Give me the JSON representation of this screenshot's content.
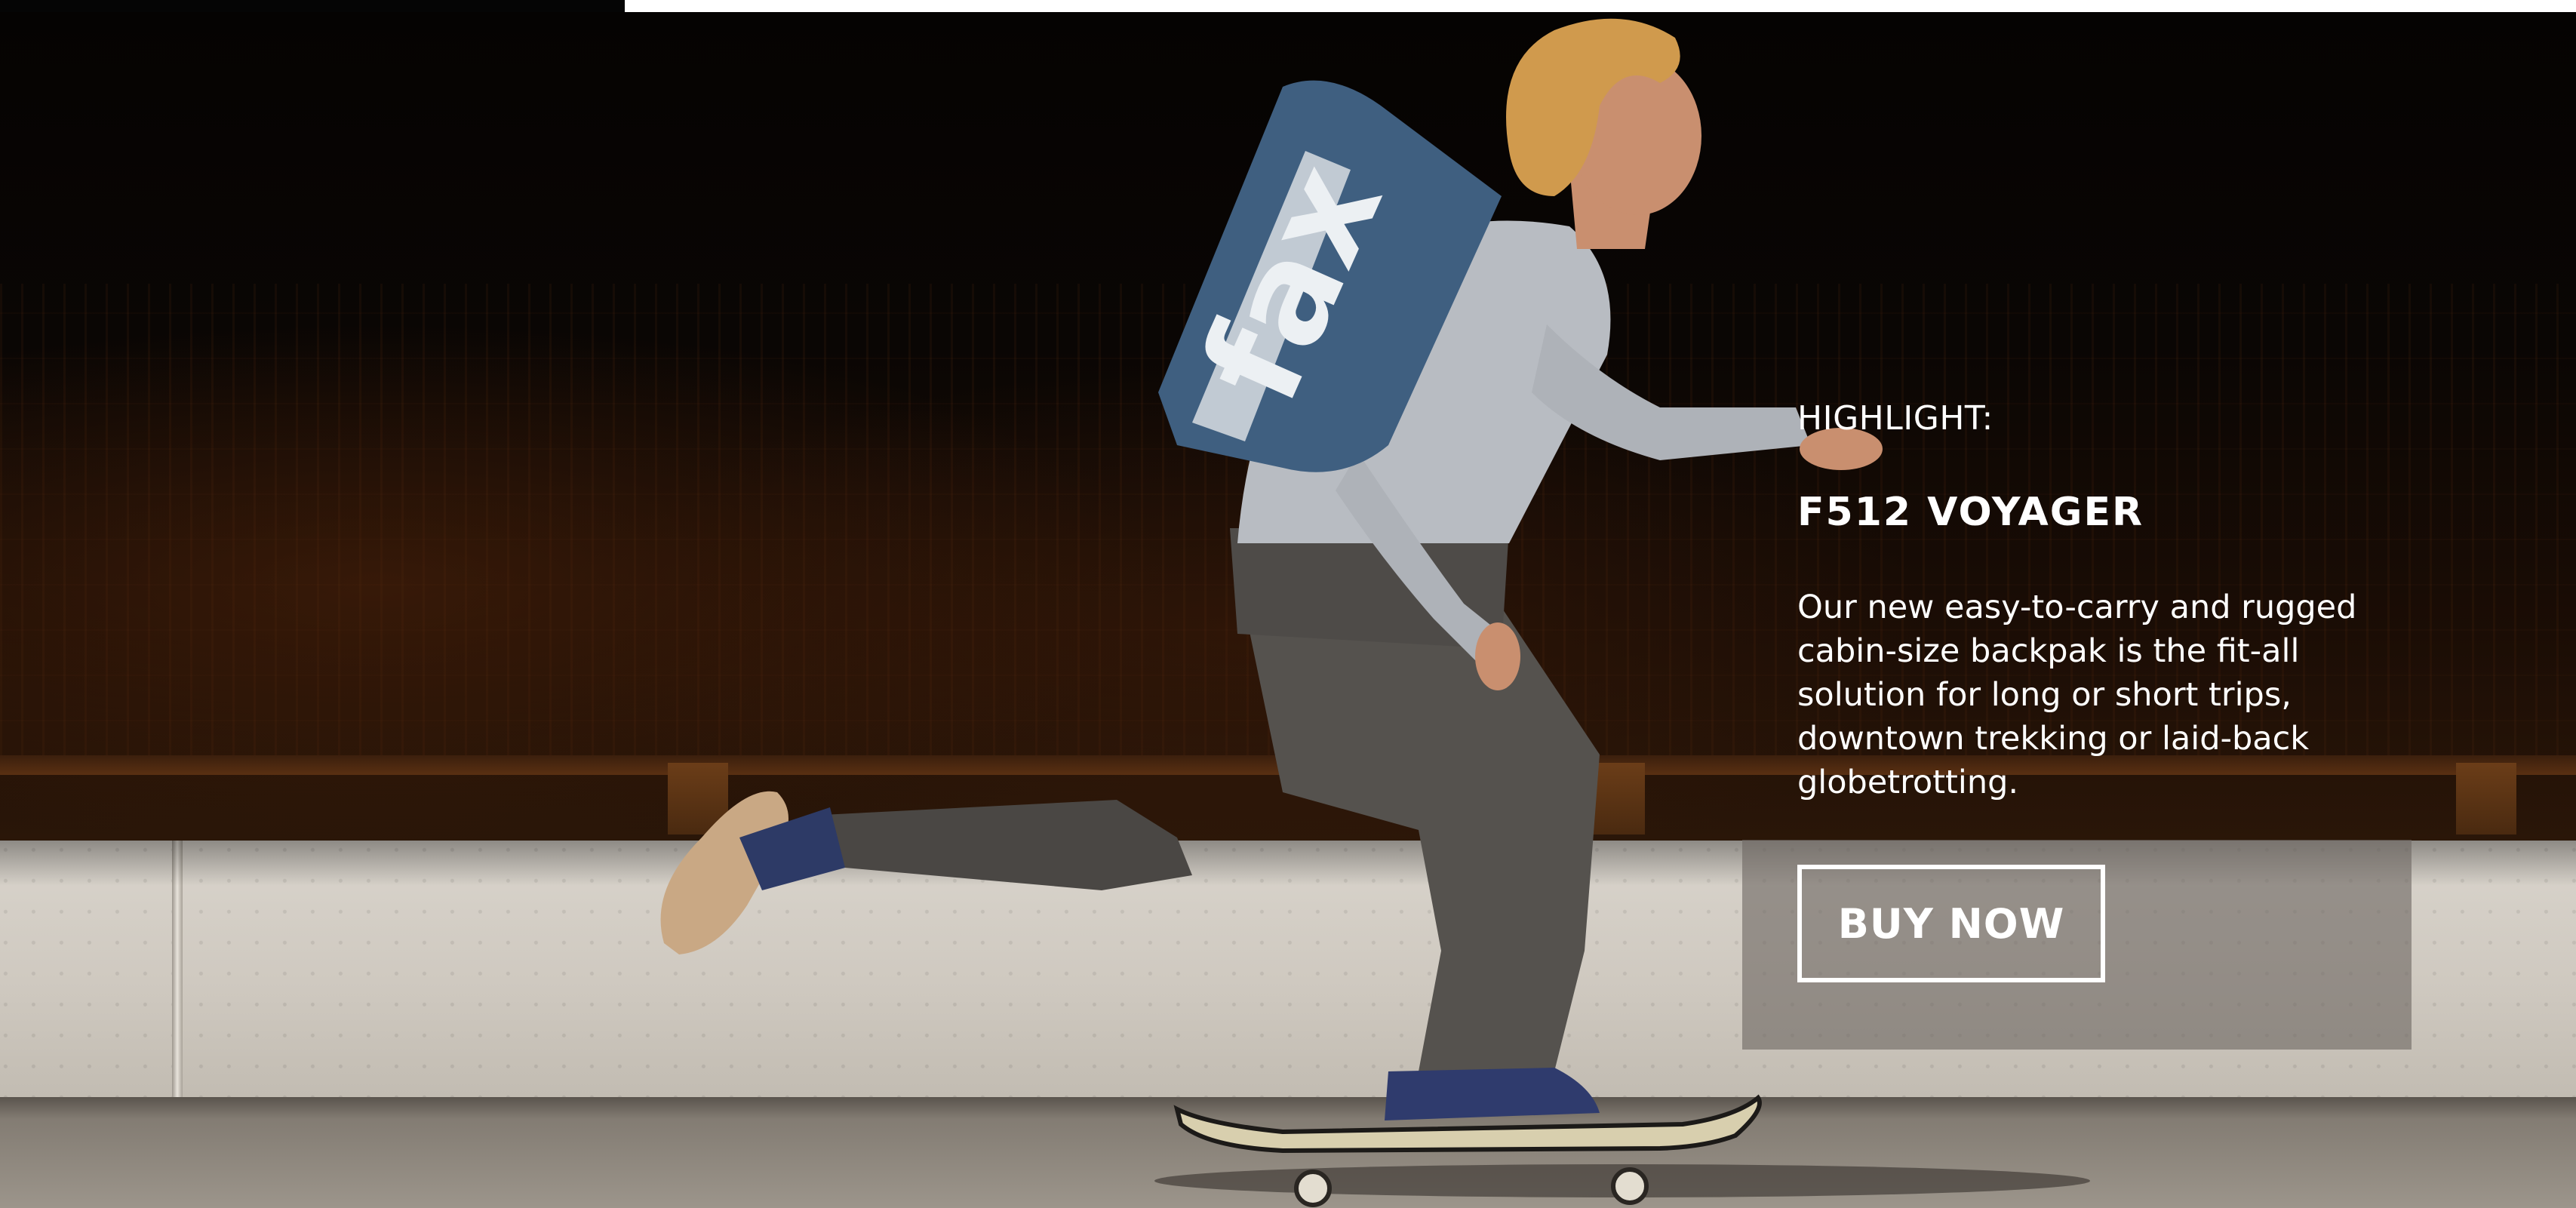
{
  "hero": {
    "eyebrow": "HIGHLIGHT:",
    "title": "F512 VOYAGER",
    "description": "Our new easy-to-carry and rugged cabin-size backpak is the fit-all solution for long or short trips, downtown trekking or laid-back globetrotting.",
    "cta_label": "BUY NOW",
    "backpack_print": "fax"
  },
  "colors": {
    "text": "#ffffff",
    "panel": "#6e6862",
    "backdrop": "#0a0604",
    "wall": "#d4cfc7",
    "pavement": "#8f887f"
  }
}
